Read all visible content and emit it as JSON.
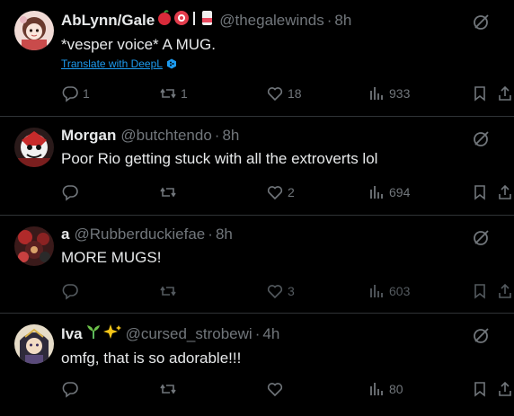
{
  "tweets": [
    {
      "display_name": "AbLynn/Gale",
      "name_emojis": "🍎 🌸 | 🧃",
      "handle": "@thegalewinds",
      "dot": "·",
      "time": "8h",
      "text": "*vesper voice* A MUG.",
      "translate_label": "Translate with DeepL",
      "replies": "1",
      "retweets": "1",
      "likes": "18",
      "views": "933"
    },
    {
      "display_name": "Morgan",
      "handle": "@butchtendo",
      "dot": "·",
      "time": "8h",
      "text": "Poor Rio getting stuck with all the extroverts lol",
      "replies": "",
      "retweets": "",
      "likes": "2",
      "views": "694"
    },
    {
      "display_name": "a",
      "handle": "@Rubberduckiefae",
      "dot": "·",
      "time": "8h",
      "text": "MORE MUGS!",
      "replies": "",
      "retweets": "",
      "likes": "3",
      "views": "603"
    },
    {
      "display_name": "Iva",
      "name_emojis": "🌱✨",
      "handle": "@cursed_strobewi",
      "dot": "·",
      "time": "4h",
      "text": "omfg, that is so adorable!!!",
      "replies": "",
      "retweets": "",
      "likes": "",
      "views": "80"
    }
  ],
  "colors": {
    "background": "#000000",
    "text_primary": "#e7e9ea",
    "text_secondary": "#71767b",
    "link": "#1d9bf0",
    "divider": "#2f3336"
  }
}
